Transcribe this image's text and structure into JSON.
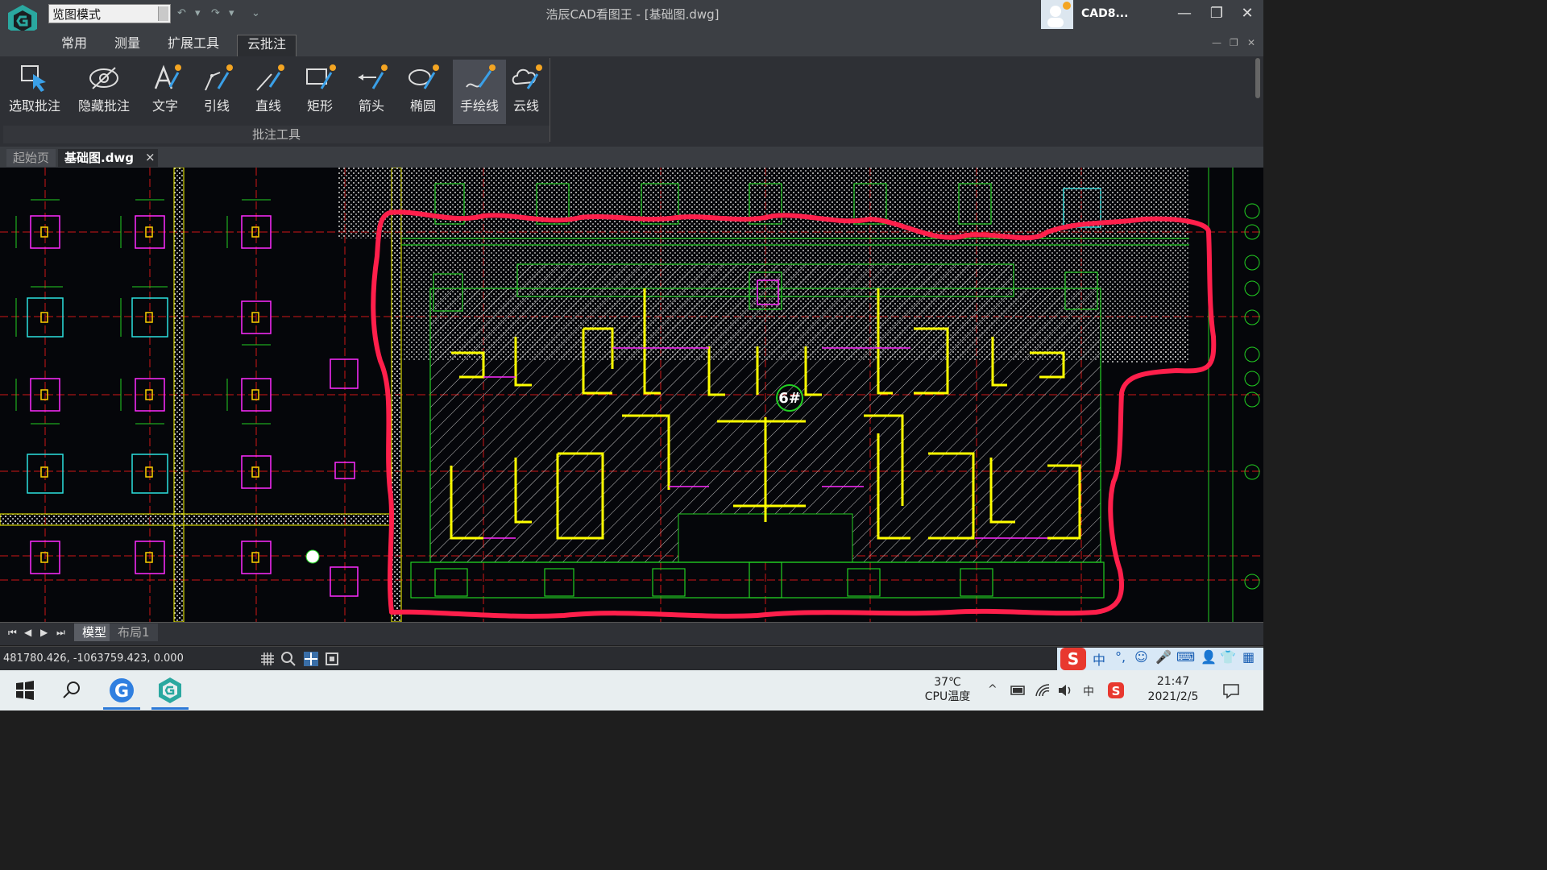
{
  "window": {
    "title": "浩辰CAD看图王 - [基础图.dwg]",
    "user": "CAD8...",
    "mode_select": "览图模式"
  },
  "menu": {
    "tabs": [
      "常用",
      "测量",
      "扩展工具",
      "云批注"
    ],
    "active": "云批注"
  },
  "ribbon": {
    "group_label": "批注工具",
    "tools": [
      {
        "label": "选取批注",
        "icon": "select-annotation-icon"
      },
      {
        "label": "隐藏批注",
        "icon": "hide-annotation-icon"
      },
      {
        "label": "文字",
        "icon": "text-icon"
      },
      {
        "label": "引线",
        "icon": "leader-icon"
      },
      {
        "label": "直线",
        "icon": "line-icon"
      },
      {
        "label": "矩形",
        "icon": "rectangle-icon"
      },
      {
        "label": "箭头",
        "icon": "arrow-icon"
      },
      {
        "label": "椭圆",
        "icon": "ellipse-icon"
      },
      {
        "label": "手绘线",
        "icon": "freehand-icon"
      },
      {
        "label": "云线",
        "icon": "cloud-icon"
      }
    ],
    "active_tool": "手绘线"
  },
  "doc_tabs": {
    "start": "起始页",
    "file": "基础图.dwg",
    "close": "×"
  },
  "drawing": {
    "building_tag": "6#"
  },
  "layout_tabs": {
    "model": "模型",
    "layout": "布局1"
  },
  "status": {
    "coordinates": "481780.426, -1063759.423, 0.000"
  },
  "ime": {
    "items": [
      "中",
      "°,",
      "☺",
      "🎤",
      "⌨",
      "👤",
      "👕",
      "▦"
    ]
  },
  "taskbar": {
    "temperature": "37℃",
    "temperature_label": "CPU温度",
    "time": "21:47",
    "date": "2021/2/5",
    "tray_lang": "中"
  },
  "colors": {
    "annotation_red": "#ff1f4b",
    "wall_yellow": "#ffff00",
    "grid_red": "#e01010",
    "ribbon_bg": "#2e3035"
  }
}
